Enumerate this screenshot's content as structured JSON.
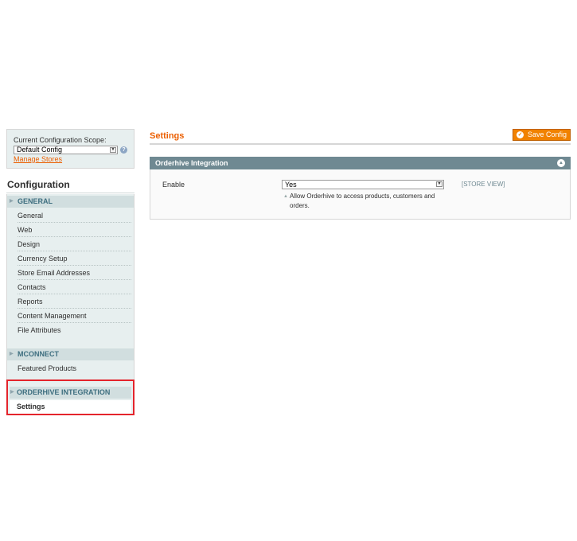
{
  "sidebar": {
    "scope_label": "Current Configuration Scope:",
    "scope_value": "Default Config",
    "manage_stores": "Manage Stores",
    "config_title": "Configuration",
    "sections": [
      {
        "title": "GENERAL",
        "items": [
          "General",
          "Web",
          "Design",
          "Currency Setup",
          "Store Email Addresses",
          "Contacts",
          "Reports",
          "Content Management",
          "File Attributes"
        ]
      },
      {
        "title": "MCONNECT",
        "items": [
          "Featured Products"
        ]
      },
      {
        "title": "ORDERHIVE INTEGRATION",
        "items": [
          "Settings"
        ]
      }
    ]
  },
  "main": {
    "title": "Settings",
    "save_label": "Save Config",
    "fieldset_title": "Orderhive Integration",
    "field": {
      "label": "Enable",
      "value": "Yes",
      "note": "Allow Orderhive to access products, customers and orders.",
      "scope": "[STORE VIEW]"
    }
  },
  "colors": {
    "accent": "#eb5e00",
    "button": "#f18200",
    "section_header": "#d1dedf",
    "fieldset_header": "#6f8992",
    "highlight": "#e4242c"
  }
}
